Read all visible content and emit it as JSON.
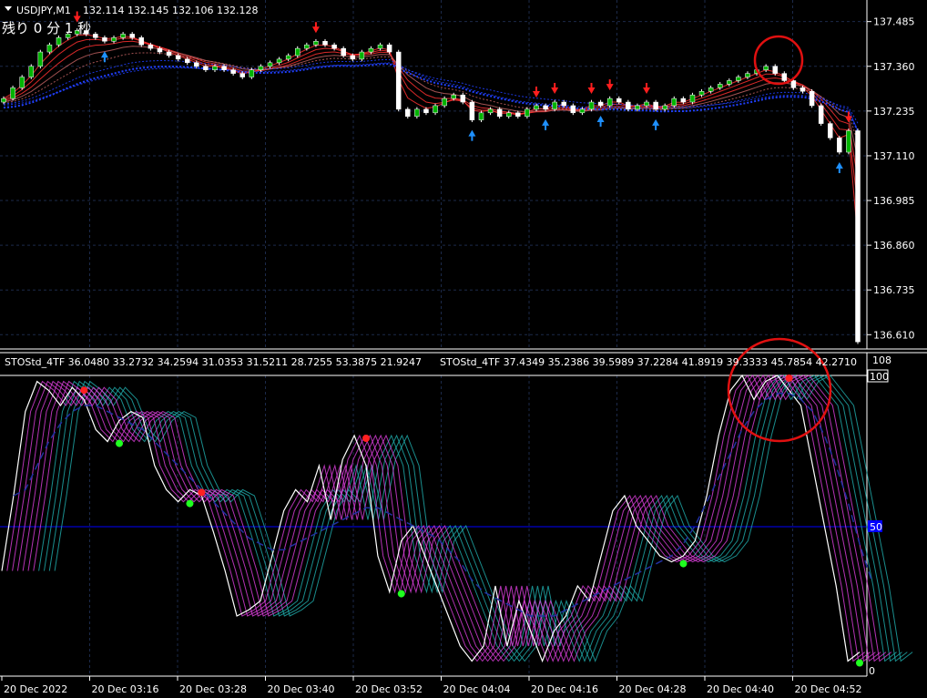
{
  "colors": {
    "background": "#000000",
    "grid": "#1c2a4a",
    "axis": "#ffffff",
    "bull_candle": "#00b400",
    "bear_candle": "#ffffff",
    "buy_arrow": "#1e90ff",
    "sell_arrow": "#ff1e1e",
    "ribbon_fast": "#ff3030",
    "ribbon_slow": "#2040ff",
    "sto_fast": "#ffffff",
    "sto_mid": "#e040e0",
    "sto_slow": "#20b0b0",
    "sto_signal": "#2030a0",
    "level_line": "#0000ff",
    "circle": "#e01010",
    "dot_buy": "#20ff20",
    "dot_sell": "#ff2020"
  },
  "header": {
    "menu_icon": "triangle-down-icon",
    "symbol": "USDJPY,M1",
    "ohlc": "132.114 132.145 132.106 132.128",
    "countdown": "残り 0 分 1 秒"
  },
  "indicator_header": {
    "text1": "STOStd_4TF 36.0480 33.2732 34.2594 31.0353 31.5211 28.7255 53.3875 21.9247",
    "text2": "STOStd_4TF 37.4349 35.2386 39.5989 37.2284 41.8919 39.3333 45.7854 42.2710"
  },
  "chart_data": [
    {
      "type": "candlestick",
      "title": "USDJPY,M1",
      "y_ticks": [
        "137.485",
        "137.360",
        "137.235",
        "137.110",
        "136.985",
        "136.860",
        "136.735",
        "136.610"
      ],
      "ylim": [
        136.57,
        137.53
      ],
      "series": [
        {
          "name": "close",
          "values": [
            137.27,
            137.3,
            137.33,
            137.36,
            137.4,
            137.42,
            137.44,
            137.45,
            137.46,
            137.45,
            137.44,
            137.43,
            137.44,
            137.45,
            137.44,
            137.42,
            137.41,
            137.4,
            137.39,
            137.38,
            137.37,
            137.36,
            137.35,
            137.36,
            137.35,
            137.34,
            137.33,
            137.35,
            137.36,
            137.37,
            137.38,
            137.39,
            137.41,
            137.42,
            137.43,
            137.42,
            137.41,
            137.39,
            137.38,
            137.4,
            137.41,
            137.42,
            137.4,
            137.24,
            137.22,
            137.24,
            137.23,
            137.25,
            137.27,
            137.28,
            137.26,
            137.21,
            137.23,
            137.24,
            137.22,
            137.23,
            137.22,
            137.24,
            137.25,
            137.24,
            137.26,
            137.25,
            137.23,
            137.24,
            137.26,
            137.25,
            137.27,
            137.26,
            137.24,
            137.25,
            137.26,
            137.24,
            137.25,
            137.27,
            137.26,
            137.28,
            137.29,
            137.3,
            137.31,
            137.32,
            137.33,
            137.34,
            137.35,
            137.36,
            137.34,
            137.32,
            137.3,
            137.29,
            137.25,
            137.2,
            137.16,
            137.12,
            137.18,
            136.59
          ]
        }
      ]
    },
    {
      "type": "line",
      "title": "STOStd_4TF",
      "y_ticks": [
        "100",
        "50",
        "0"
      ],
      "ylim": [
        0,
        108
      ],
      "series": [
        {
          "name": "fast",
          "values": [
            35,
            60,
            88,
            98,
            95,
            90,
            96,
            92,
            82,
            78,
            85,
            88,
            86,
            70,
            62,
            58,
            62,
            60,
            48,
            35,
            20,
            22,
            25,
            40,
            55,
            62,
            58,
            70,
            52,
            72,
            80,
            70,
            40,
            28,
            45,
            50,
            40,
            30,
            20,
            10,
            5,
            10,
            30,
            10,
            25,
            15,
            5,
            15,
            20,
            30,
            25,
            40,
            55,
            60,
            50,
            45,
            40,
            38,
            40,
            45,
            60,
            80,
            95,
            100,
            92,
            98,
            100,
            95,
            90,
            70,
            50,
            30,
            5,
            8
          ]
        },
        {
          "name": "slow",
          "values": [
            60,
            62,
            70,
            78,
            84,
            88,
            90,
            90,
            88,
            86,
            84,
            82,
            78,
            74,
            70,
            66,
            62,
            58,
            54,
            50,
            46,
            44,
            42,
            42,
            44,
            46,
            48,
            50,
            52,
            54,
            56,
            56,
            54,
            52,
            50,
            48,
            46,
            42,
            38,
            32,
            28,
            26,
            24,
            22,
            20,
            20,
            20,
            22,
            24,
            26,
            28,
            30,
            32,
            34,
            36,
            38,
            40,
            44,
            50,
            58,
            66,
            74,
            82,
            88,
            92,
            94,
            94,
            92,
            88,
            80,
            70,
            58,
            44,
            32
          ]
        }
      ]
    }
  ],
  "time_labels": [
    "20 Dec 2022",
    "20 Dec 03:16",
    "20 Dec 03:28",
    "20 Dec 03:40",
    "20 Dec 03:52",
    "20 Dec 04:04",
    "20 Dec 04:16",
    "20 Dec 04:28",
    "20 Dec 04:40",
    "20 Dec 04:52"
  ],
  "ind_scale_top": "108",
  "ind_scale_100": "100",
  "ind_scale_50": "50",
  "ind_scale_0": "0"
}
